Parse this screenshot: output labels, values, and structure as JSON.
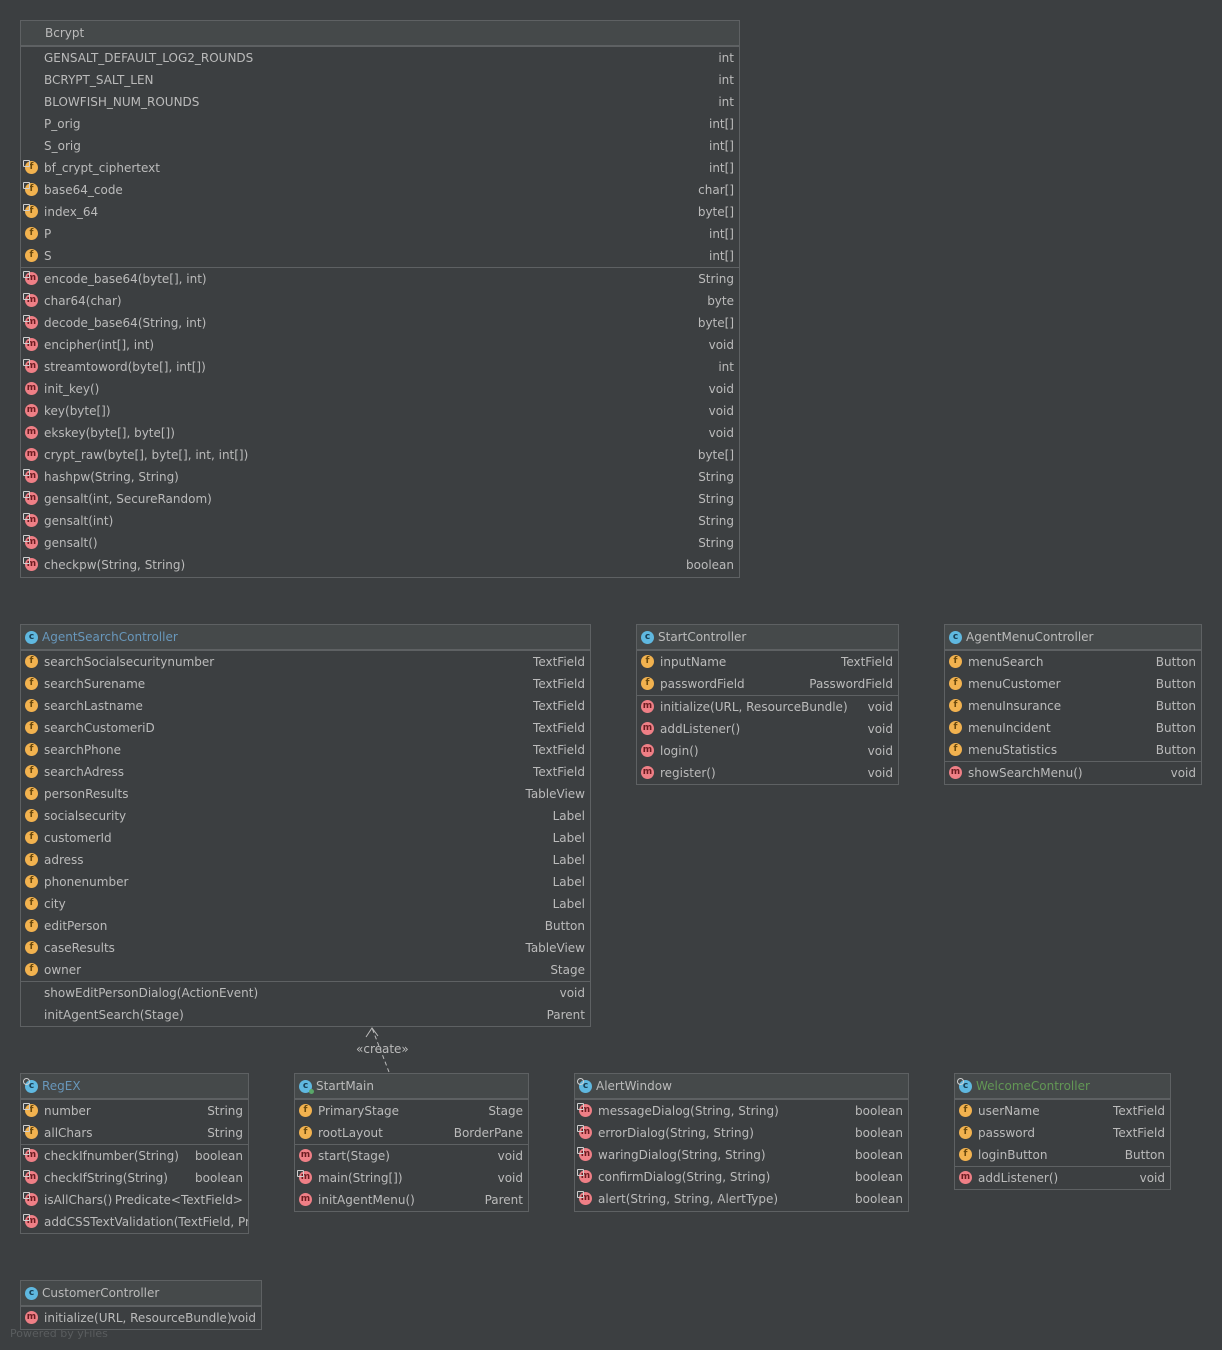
{
  "bcrypt": {
    "title": "Bcrypt",
    "fields": [
      {
        "name": "GENSALT_DEFAULT_LOG2_ROUNDS",
        "type": "int",
        "icon": "none"
      },
      {
        "name": "BCRYPT_SALT_LEN",
        "type": "int",
        "icon": "none"
      },
      {
        "name": "BLOWFISH_NUM_ROUNDS",
        "type": "int",
        "icon": "none"
      },
      {
        "name": "P_orig",
        "type": "int[]",
        "icon": "none"
      },
      {
        "name": "S_orig",
        "type": "int[]",
        "icon": "none"
      },
      {
        "name": "bf_crypt_ciphertext",
        "type": "int[]",
        "icon": "field-icon-static"
      },
      {
        "name": "base64_code",
        "type": "char[]",
        "icon": "field-icon-static"
      },
      {
        "name": "index_64",
        "type": "byte[]",
        "icon": "field-icon-static"
      },
      {
        "name": "P",
        "type": "int[]",
        "icon": "field-icon"
      },
      {
        "name": "S",
        "type": "int[]",
        "icon": "field-icon"
      }
    ],
    "methods": [
      {
        "name": "encode_base64(byte[], int)",
        "type": "String",
        "icon": "method-icon-static"
      },
      {
        "name": "char64(char)",
        "type": "byte",
        "icon": "method-icon-static"
      },
      {
        "name": "decode_base64(String, int)",
        "type": "byte[]",
        "icon": "method-icon-static"
      },
      {
        "name": "encipher(int[], int)",
        "type": "void",
        "icon": "method-icon-static"
      },
      {
        "name": "streamtoword(byte[], int[])",
        "type": "int",
        "icon": "method-icon-static"
      },
      {
        "name": "init_key()",
        "type": "void",
        "icon": "method-icon"
      },
      {
        "name": "key(byte[])",
        "type": "void",
        "icon": "method-icon"
      },
      {
        "name": "ekskey(byte[], byte[])",
        "type": "void",
        "icon": "method-icon"
      },
      {
        "name": "crypt_raw(byte[], byte[], int, int[])",
        "type": "byte[]",
        "icon": "method-icon"
      },
      {
        "name": "hashpw(String, String)",
        "type": "String",
        "icon": "method-icon-static"
      },
      {
        "name": "gensalt(int, SecureRandom)",
        "type": "String",
        "icon": "method-icon-static"
      },
      {
        "name": "gensalt(int)",
        "type": "String",
        "icon": "method-icon-static"
      },
      {
        "name": "gensalt()",
        "type": "String",
        "icon": "method-icon-static"
      },
      {
        "name": "checkpw(String, String)",
        "type": "boolean",
        "icon": "method-icon-static"
      }
    ]
  },
  "agent_search": {
    "title": "AgentSearchController",
    "fields": [
      {
        "name": "searchSocialsecuritynumber",
        "type": "TextField",
        "icon": "field-icon"
      },
      {
        "name": "searchSurename",
        "type": "TextField",
        "icon": "field-icon"
      },
      {
        "name": "searchLastname",
        "type": "TextField",
        "icon": "field-icon"
      },
      {
        "name": "searchCustomeriD",
        "type": "TextField",
        "icon": "field-icon"
      },
      {
        "name": "searchPhone",
        "type": "TextField",
        "icon": "field-icon"
      },
      {
        "name": "searchAdress",
        "type": "TextField",
        "icon": "field-icon"
      },
      {
        "name": "personResults",
        "type": "TableView",
        "icon": "field-icon"
      },
      {
        "name": "socialsecurity",
        "type": "Label",
        "icon": "field-icon"
      },
      {
        "name": "customerId",
        "type": "Label",
        "icon": "field-icon"
      },
      {
        "name": "adress",
        "type": "Label",
        "icon": "field-icon"
      },
      {
        "name": "phonenumber",
        "type": "Label",
        "icon": "field-icon"
      },
      {
        "name": "city",
        "type": "Label",
        "icon": "field-icon"
      },
      {
        "name": "editPerson",
        "type": "Button",
        "icon": "field-icon"
      },
      {
        "name": "caseResults",
        "type": "TableView",
        "icon": "field-icon"
      },
      {
        "name": "owner",
        "type": "Stage",
        "icon": "field-icon"
      }
    ],
    "methods": [
      {
        "name": "showEditPersonDialog(ActionEvent)",
        "type": "void",
        "icon": "none"
      },
      {
        "name": "initAgentSearch(Stage)",
        "type": "Parent",
        "icon": "none"
      }
    ]
  },
  "start_controller": {
    "title": "StartController",
    "fields": [
      {
        "name": "inputName",
        "type": "TextField",
        "icon": "field-icon"
      },
      {
        "name": "passwordField",
        "type": "PasswordField",
        "icon": "field-icon"
      }
    ],
    "methods": [
      {
        "name": "initialize(URL, ResourceBundle)",
        "type": "void",
        "icon": "method-icon"
      },
      {
        "name": "addListener()",
        "type": "void",
        "icon": "method-icon"
      },
      {
        "name": "login()",
        "type": "void",
        "icon": "method-icon"
      },
      {
        "name": "register()",
        "type": "void",
        "icon": "method-icon"
      }
    ]
  },
  "agent_menu": {
    "title": "AgentMenuController",
    "fields": [
      {
        "name": "menuSearch",
        "type": "Button",
        "icon": "field-icon"
      },
      {
        "name": "menuCustomer",
        "type": "Button",
        "icon": "field-icon"
      },
      {
        "name": "menuInsurance",
        "type": "Button",
        "icon": "field-icon"
      },
      {
        "name": "menuIncident",
        "type": "Button",
        "icon": "field-icon"
      },
      {
        "name": "menuStatistics",
        "type": "Button",
        "icon": "field-icon"
      }
    ],
    "methods": [
      {
        "name": "showSearchMenu()",
        "type": "void",
        "icon": "method-icon"
      }
    ]
  },
  "regex": {
    "title": "RegEX",
    "fields": [
      {
        "name": "number",
        "type": "String",
        "icon": "field-icon-static"
      },
      {
        "name": "allChars",
        "type": "String",
        "icon": "field-icon-static"
      }
    ],
    "methods": [
      {
        "name": "checkIfnumber(String)",
        "type": "boolean",
        "icon": "method-icon-static"
      },
      {
        "name": "checkIfString(String)",
        "type": "boolean",
        "icon": "method-icon-static"
      },
      {
        "name": "isAllChars()",
        "type": "Predicate<TextField>",
        "icon": "method-icon-static"
      },
      {
        "name": "addCSSTextValidation(TextField, Predic",
        "type": "",
        "icon": "method-icon-static"
      }
    ]
  },
  "start_main": {
    "title": "StartMain",
    "fields": [
      {
        "name": "PrimaryStage",
        "type": "Stage",
        "icon": "field-icon"
      },
      {
        "name": "rootLayout",
        "type": "BorderPane",
        "icon": "field-icon"
      }
    ],
    "methods": [
      {
        "name": "start(Stage)",
        "type": "void",
        "icon": "method-icon"
      },
      {
        "name": "main(String[])",
        "type": "void",
        "icon": "method-icon-static"
      },
      {
        "name": "initAgentMenu()",
        "type": "Parent",
        "icon": "method-icon"
      }
    ]
  },
  "alert_window": {
    "title": "AlertWindow",
    "fields": [],
    "methods": [
      {
        "name": "messageDialog(String, String)",
        "type": "boolean",
        "icon": "method-icon-static"
      },
      {
        "name": "errorDialog(String, String)",
        "type": "boolean",
        "icon": "method-icon-static"
      },
      {
        "name": "waringDialog(String, String)",
        "type": "boolean",
        "icon": "method-icon-static"
      },
      {
        "name": "confirmDialog(String, String)",
        "type": "boolean",
        "icon": "method-icon-static"
      },
      {
        "name": "alert(String, String, AlertType)",
        "type": "boolean",
        "icon": "method-icon-static"
      }
    ]
  },
  "welcome_controller": {
    "title": "WelcomeController",
    "fields": [
      {
        "name": "userName",
        "type": "TextField",
        "icon": "field-icon"
      },
      {
        "name": "password",
        "type": "TextField",
        "icon": "field-icon"
      },
      {
        "name": "loginButton",
        "type": "Button",
        "icon": "field-icon"
      }
    ],
    "methods": [
      {
        "name": "addListener()",
        "type": "void",
        "icon": "method-icon"
      }
    ]
  },
  "customer_controller": {
    "title": "CustomerController",
    "fields": [],
    "methods": [
      {
        "name": "initialize(URL, ResourceBundle)",
        "type": "void",
        "icon": "method-icon"
      }
    ]
  },
  "edge": {
    "label": "«create»"
  },
  "watermark": "Powered by yFiles",
  "colors": {
    "background": "#3c3f41",
    "field_icon": "#f2b24f",
    "method_icon": "#ef7f86",
    "class_icon": "#5fb8e0",
    "link_title": "#6897bb",
    "green_title": "#629755"
  }
}
